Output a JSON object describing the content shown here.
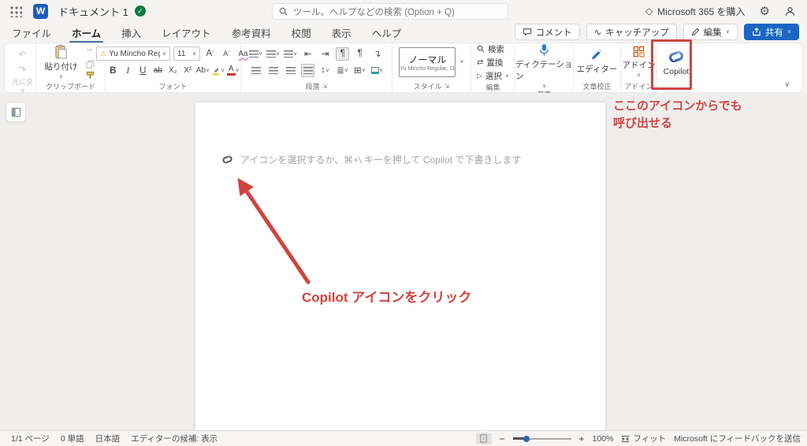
{
  "colors": {
    "accent_red": "#d0443f",
    "share_blue": "#1a66c2",
    "word_blue": "#1a5dbe",
    "tab_underline": "#49709f"
  },
  "icons": {
    "chevron_down": "∨",
    "caret_up": "ˆ",
    "caret_down": "ˇ",
    "undo": "↶",
    "redo": "↷",
    "scissors": "✂",
    "warning": "⚠",
    "diamond": "◇",
    "gear": "⚙",
    "wave": "∿",
    "check": "✓",
    "outdent": "⇤",
    "indent": "⇥",
    "pilcrow": "¶",
    "return_arrow": "↴",
    "line_spacing": "↕",
    "shading": "≣",
    "borders": "⊞",
    "replace": "⇄",
    "select_triangle": "▷",
    "launcher": "⇲",
    "minus": "−",
    "plus": "+"
  },
  "header": {
    "title": "ドキュメント 1",
    "search_placeholder": "ツール、ヘルプなどの検索 (Option + Q)",
    "buy": "Microsoft 365 を購入"
  },
  "menu": {
    "tabs": [
      "ファイル",
      "ホーム",
      "挿入",
      "レイアウト",
      "参考資料",
      "校閲",
      "表示",
      "ヘルプ"
    ],
    "comments": "コメント",
    "catchup": "キャッチアップ",
    "edit": "編集",
    "share": "共有"
  },
  "ribbon": {
    "undo_group": "元に戻す",
    "paste": "貼り付け",
    "clipboard_group": "クリップボード",
    "font_name": "Yu Mincho Reg...",
    "font_size": "11",
    "grow_letter": "A",
    "shrink_letter": "A",
    "case_letters": "Aa",
    "bold": "B",
    "italic": "I",
    "underline": "U",
    "strikethrough": "ab",
    "subscript": "X₂",
    "superscript": "X²",
    "effects": "Ab",
    "font_color_letter": "A",
    "font_group": "フォント",
    "paragraph_group": "段落",
    "style_name": "ノーマル",
    "style_detail": "Yu Mincho Regular, 11",
    "styles_group": "スタイル",
    "find": "検索",
    "replace": "置換",
    "select": "選択",
    "editing_group": "編集",
    "dictation": "ディクテーション",
    "voice_group": "音声",
    "editor": "エディター",
    "proofing_group": "文章校正",
    "addins": "アドイン",
    "addins_group": "アドイン",
    "copilot": "Copilot"
  },
  "document": {
    "placeholder": "アイコンを選択するか、⌘+\\ キーを押して Copilot で下書きします"
  },
  "annotations": {
    "callout_top": "ここのアイコンからでも\n呼び出せる",
    "arrow_label": "Copilot アイコンをクリック"
  },
  "statusbar": {
    "items": [
      "1/1 ページ",
      "0 単語",
      "日本語",
      "エディターの候補: 表示"
    ],
    "zoom": "100%",
    "fit": "フィット",
    "feedback": "Microsoft にフィードバックを送信"
  }
}
